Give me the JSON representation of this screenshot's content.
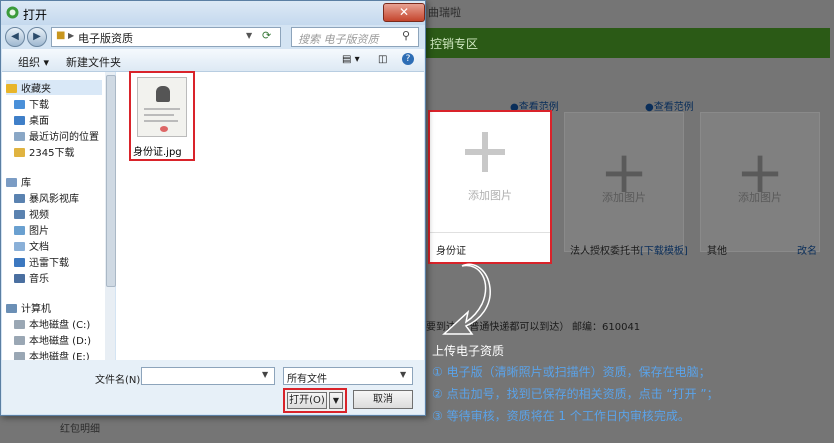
{
  "background": {
    "top_text": "曲瑞啦",
    "section_title": "控销专区",
    "view_links": [
      "●查看范例",
      "●查看范例"
    ],
    "cards": [
      {
        "plus_text": "添加图片",
        "label": "身份证"
      },
      {
        "plus_text": "添加图片",
        "label": "法人授权委托书",
        "link": "[下载模板]"
      },
      {
        "plus_text": "添加图片",
        "label": "其他",
        "link": "改名"
      }
    ],
    "address_line": "（请不要到达到/普通快递都可以到达）",
    "postcode": "邮编：610041",
    "footer_text": "红包明细"
  },
  "dialog": {
    "title": "打开",
    "close_label": "✕",
    "breadcrumb": "电子版资质",
    "search_placeholder": "搜索 电子版资质",
    "toolbar": {
      "organize": "组织 ▾",
      "new_folder": "新建文件夹"
    },
    "nav": {
      "favorites_header": "收藏夹",
      "favorites": [
        "下载",
        "桌面",
        "最近访问的位置",
        "2345下载"
      ],
      "libraries_header": "库",
      "libraries": [
        "暴风影视库",
        "视频",
        "图片",
        "文档",
        "迅雷下载",
        "音乐"
      ],
      "computer_header": "计算机",
      "drives": [
        "本地磁盘 (C:)",
        "本地磁盘 (D:)",
        "本地磁盘 (E:)"
      ]
    },
    "file": {
      "name": "身份证.jpg"
    },
    "filename_label": "文件名(N):",
    "filename_value": "",
    "filetype": "所有文件",
    "open_label": "打开(O)",
    "cancel_label": "取消"
  },
  "instructions": {
    "title": "上传电子资质",
    "lines": [
      "① 电子版（清晰照片或扫描件）资质，保存在电脑；",
      "② 点击加号，找到已保存的相关资质，点击 “打开 ”；",
      "③ 等待审核，资质将在 1 个工作日内审核完成。"
    ]
  },
  "colors": {
    "highlight": "#d9232a",
    "instruction_text": "#5aa3ea",
    "section_green": "#2b5a16"
  }
}
